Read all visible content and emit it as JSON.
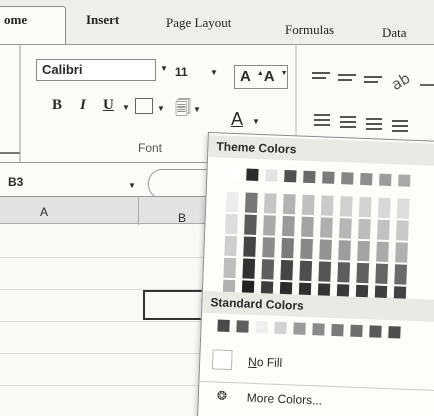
{
  "tabs": {
    "home": "ome",
    "insert": "Insert",
    "page_layout": "Page Layout",
    "formulas": "Formulas",
    "data": "Data"
  },
  "ribbon": {
    "font_name": "Calibri",
    "font_size": "11",
    "bold": "B",
    "italic": "I",
    "underline": "U",
    "font_color_glyph": "A",
    "font_group_label": "Font"
  },
  "formula_bar": {
    "name_box": "B3"
  },
  "columns": [
    "A",
    "B"
  ],
  "color_panel": {
    "theme_heading": "Theme Colors",
    "standard_heading": "Standard Colors",
    "no_fill_label_first": "N",
    "no_fill_label_rest": "o Fill",
    "more_colors_label": "More Colors...",
    "theme_top_row": [
      "#ffffff",
      "#2b2b2b",
      "#e4e4e4",
      "#505050",
      "#6a6a6a",
      "#7c7c7c",
      "#858585",
      "#8e8e8e",
      "#9d9d9d",
      "#aaaaaa"
    ],
    "theme_shade_columns": [
      [
        "#ededed",
        "#dedede",
        "#cfcfcf",
        "#bebebe",
        "#b0b0b0"
      ],
      [
        "#767676",
        "#5a5a5a",
        "#444444",
        "#323232",
        "#222222"
      ],
      [
        "#c6c6c6",
        "#a9a9a9",
        "#8c8c8c",
        "#5f5f5f",
        "#3d3d3d"
      ],
      [
        "#b3b3b3",
        "#9a9a9a",
        "#7b7b7b",
        "#454545",
        "#2c2c2c"
      ],
      [
        "#c0c0c0",
        "#a3a3a3",
        "#888888",
        "#4e4e4e",
        "#303030"
      ],
      [
        "#cbcbcb",
        "#afafaf",
        "#939393",
        "#555555",
        "#353535"
      ],
      [
        "#d0d0d0",
        "#b7b7b7",
        "#9d9d9d",
        "#5d5d5d",
        "#393939"
      ],
      [
        "#d3d3d3",
        "#bcbcbc",
        "#a3a3a3",
        "#606060",
        "#3c3c3c"
      ],
      [
        "#d8d8d8",
        "#c2c2c2",
        "#aaaaaa",
        "#656565",
        "#3f3f3f"
      ],
      [
        "#dddddd",
        "#c9c9c9",
        "#b1b1b1",
        "#6b6b6b",
        "#434343"
      ]
    ],
    "standard_colors": [
      "#4a4a4a",
      "#5e5e5e",
      "#f0f0f0",
      "#d2d2d2",
      "#9a9a9a",
      "#8a8a8a",
      "#7a7a7a",
      "#6e6e6e",
      "#5a5a5a",
      "#4d4d4d"
    ]
  }
}
